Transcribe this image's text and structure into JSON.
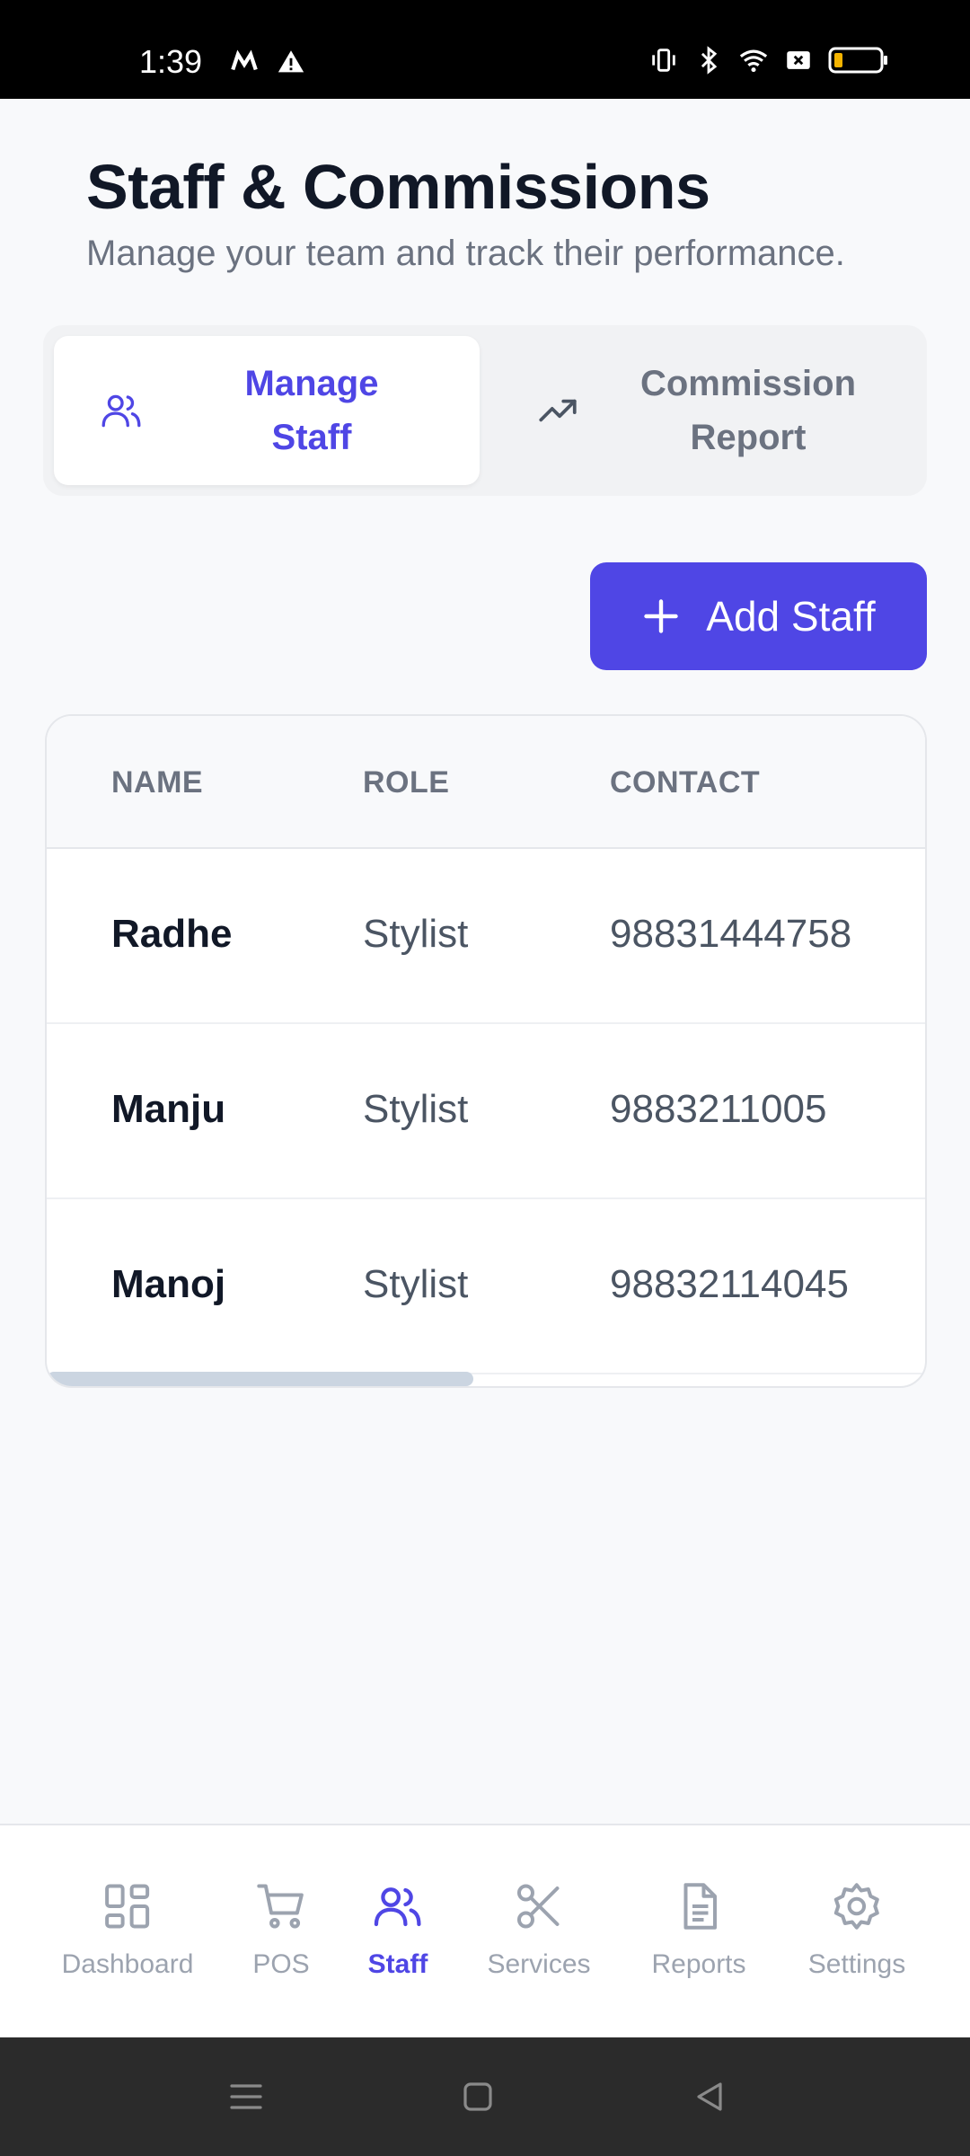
{
  "status_bar": {
    "time": "1:39",
    "icons": [
      "m-app-icon",
      "warning-icon",
      "vibrate-icon",
      "bluetooth-icon",
      "wifi-icon",
      "no-sim-icon",
      "battery-icon"
    ]
  },
  "header": {
    "title": "Staff & Commissions",
    "subtitle": "Manage your team and track their performance."
  },
  "tabs": [
    {
      "label_line1": "Manage",
      "label_line2": "Staff",
      "icon": "users-icon",
      "active": true
    },
    {
      "label_line1": "Commission",
      "label_line2": "Report",
      "icon": "trending-up-icon",
      "active": false
    }
  ],
  "add_button": {
    "label": "Add Staff",
    "icon": "plus-icon"
  },
  "table": {
    "columns": [
      "NAME",
      "ROLE",
      "CONTACT"
    ],
    "rows": [
      {
        "name": "Radhe",
        "role": "Stylist",
        "contact": "98831444758"
      },
      {
        "name": "Manju",
        "role": "Stylist",
        "contact": "9883211005"
      },
      {
        "name": "Manoj",
        "role": "Stylist",
        "contact": "98832114045"
      }
    ]
  },
  "bottom_nav": [
    {
      "label": "Dashboard",
      "icon": "dashboard-icon",
      "active": false
    },
    {
      "label": "POS",
      "icon": "cart-icon",
      "active": false
    },
    {
      "label": "Staff",
      "icon": "users-icon",
      "active": true
    },
    {
      "label": "Services",
      "icon": "scissors-icon",
      "active": false
    },
    {
      "label": "Reports",
      "icon": "document-icon",
      "active": false
    },
    {
      "label": "Settings",
      "icon": "gear-icon",
      "active": false
    }
  ],
  "colors": {
    "accent": "#4f46e5",
    "title": "#111827",
    "muted": "#6b7280",
    "background": "#f8f9fb"
  }
}
